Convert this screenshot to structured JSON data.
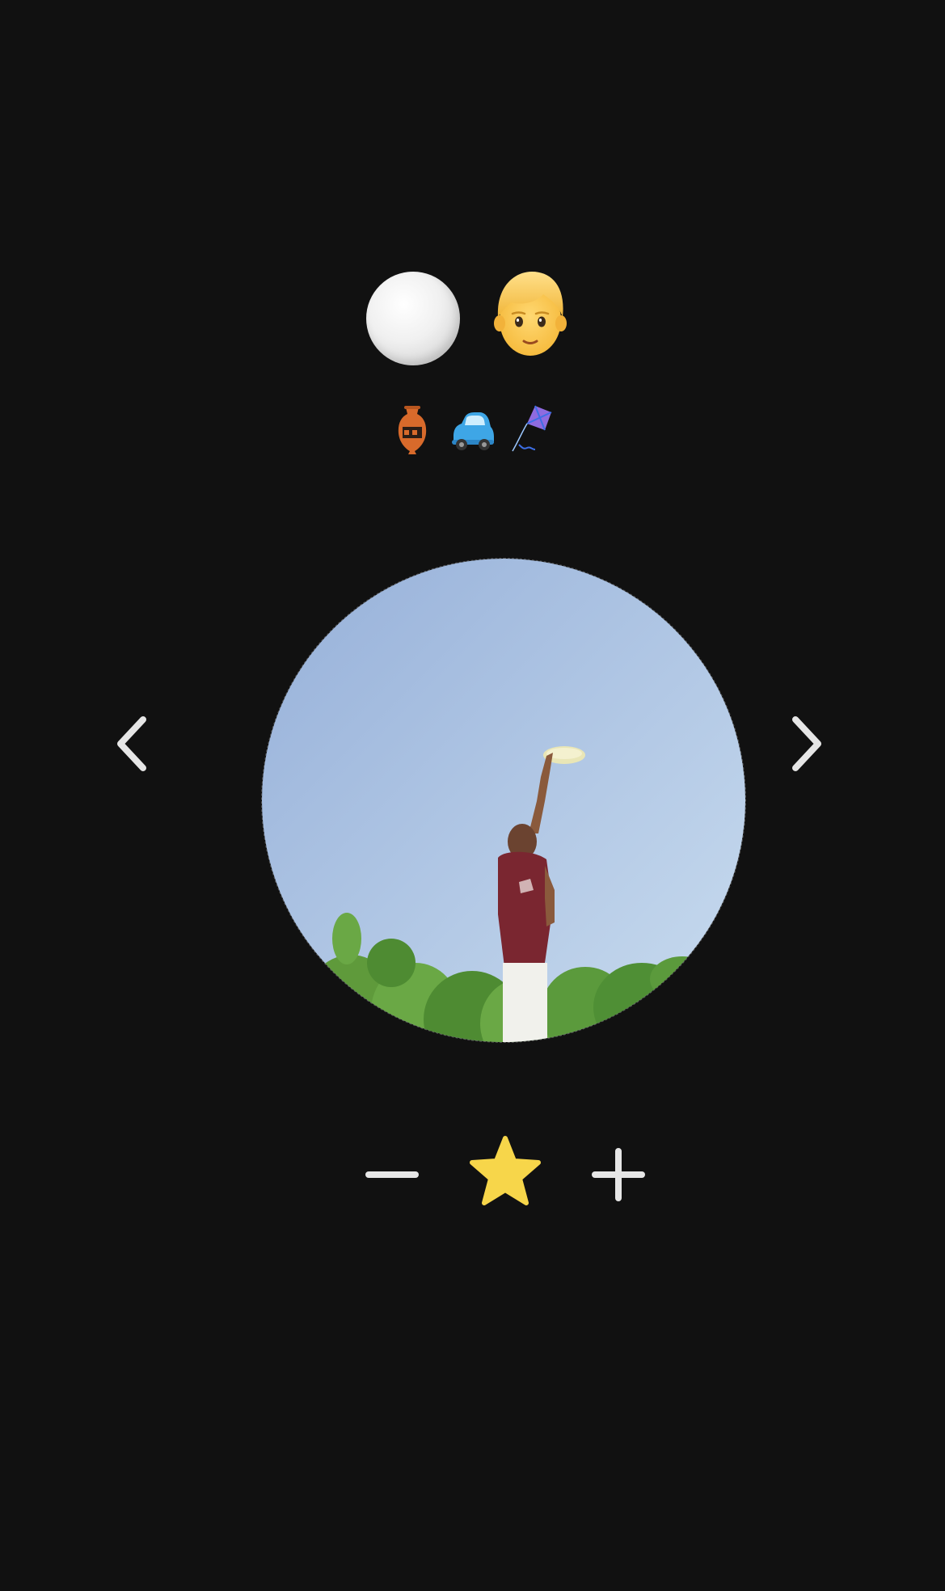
{
  "top_row": {
    "items": [
      {
        "icon": "white-circle-icon"
      },
      {
        "icon": "person-icon"
      }
    ]
  },
  "small_row": {
    "items": [
      {
        "icon": "amphora-icon"
      },
      {
        "icon": "car-icon"
      },
      {
        "icon": "kite-icon"
      }
    ]
  },
  "photo": {
    "subject": "frisbee-catch-photo"
  },
  "navigation": {
    "prev_icon": "chevron-left-icon",
    "next_icon": "chevron-right-icon"
  },
  "controls": {
    "minus_icon": "minus-icon",
    "star_icon": "star-icon",
    "plus_icon": "plus-icon"
  },
  "colors": {
    "background": "#111111",
    "icon_light": "#e6e6e6",
    "star": "#f7d64a"
  }
}
